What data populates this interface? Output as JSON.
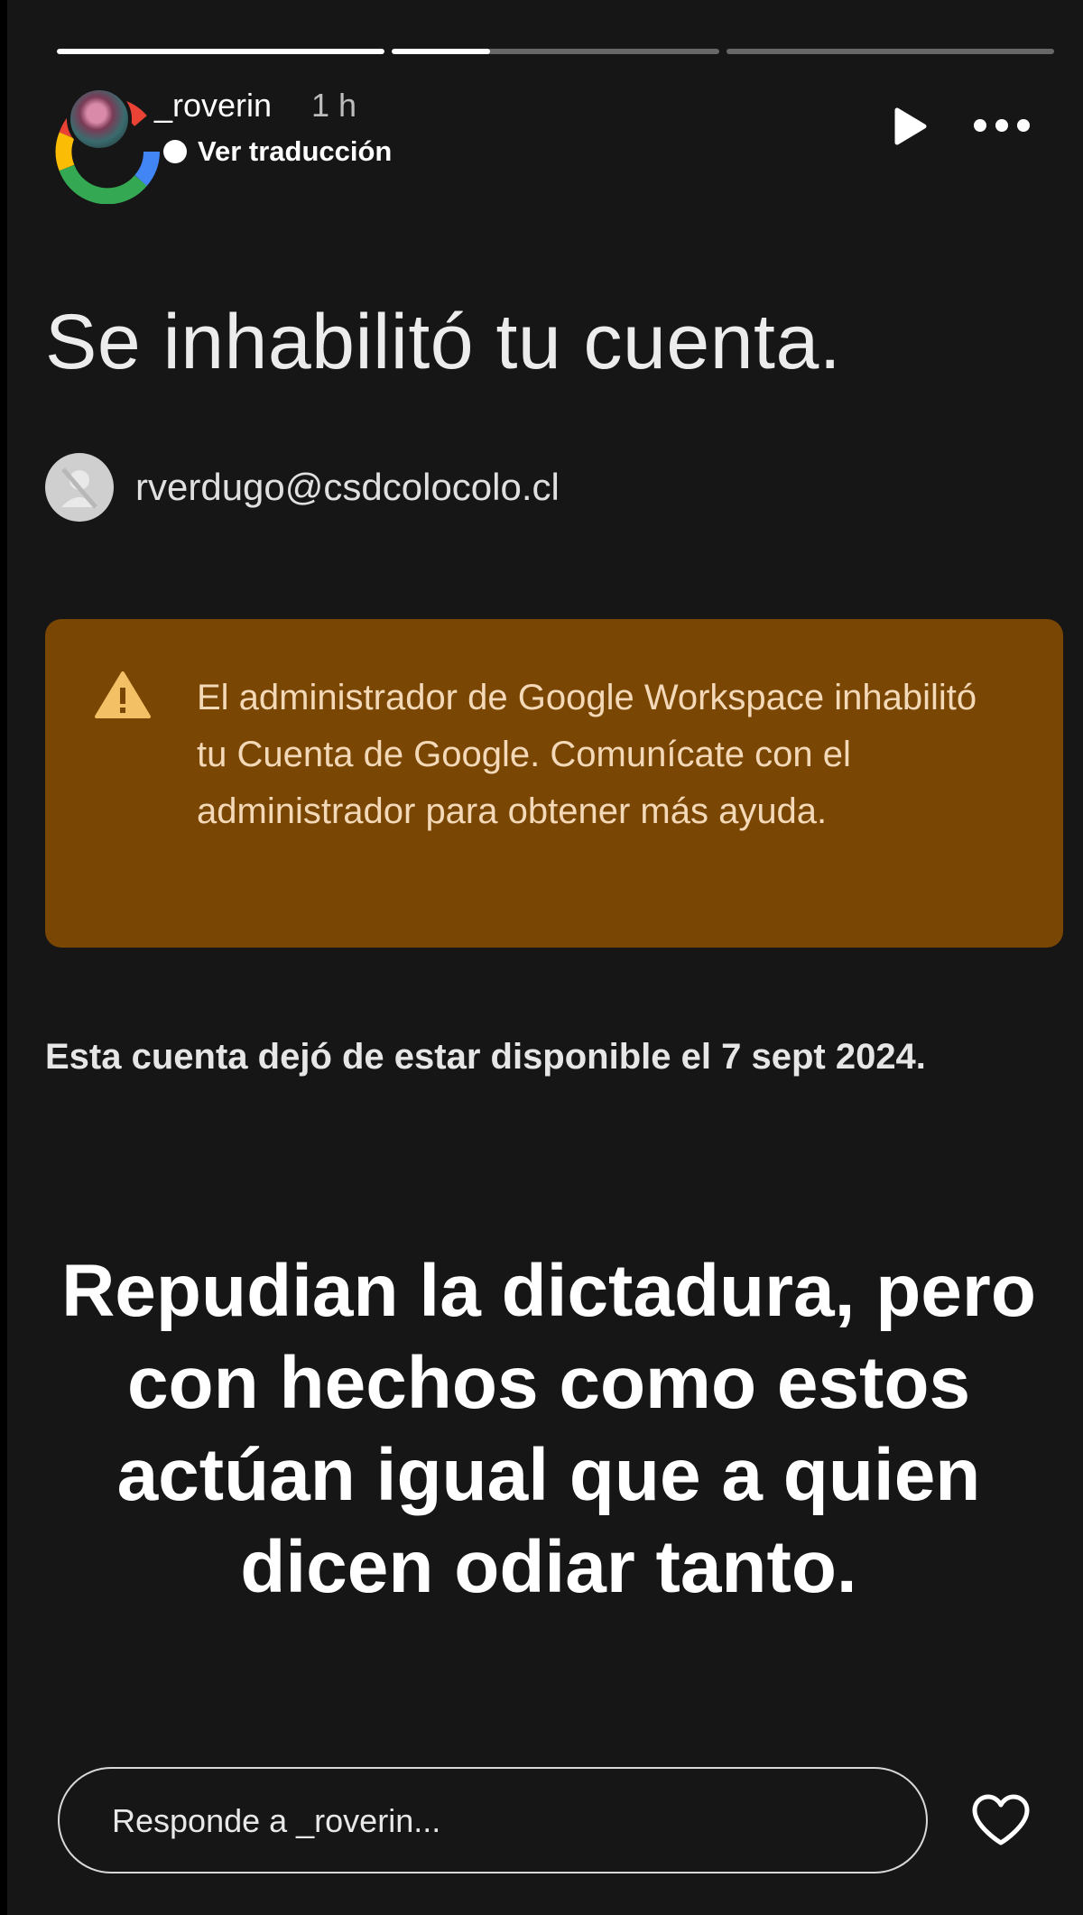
{
  "story": {
    "progress": [
      1.0,
      0.3,
      0.0
    ],
    "user": {
      "username": "_roverin",
      "time_ago": "1 h",
      "translate_label": "Ver traducción"
    },
    "reply": {
      "placeholder": "Responde a _roverin..."
    },
    "icons": {
      "play": "play-icon",
      "more": "more-options-icon",
      "heart": "heart-icon"
    }
  },
  "content": {
    "headline": "Se inhabilitó tu cuenta.",
    "account_email": "rverdugo@csdcolocolo.cl",
    "warning_text": "El administrador de Google Workspace inhabilitó tu Cuenta de Google. Comunícate con el administrador para obtener más ayuda.",
    "unavailable_text": "Esta cuenta dejó de estar disponible el 7 sept 2024.",
    "overlay_text": "Repudian la dictadura, pero con hechos como estos actúan igual que a quien dicen odiar tanto."
  },
  "colors": {
    "story_bg": "#161616",
    "warning_bg": "#7a4604",
    "warning_text": "#f3d9b8",
    "warning_icon": "#f4c066"
  }
}
